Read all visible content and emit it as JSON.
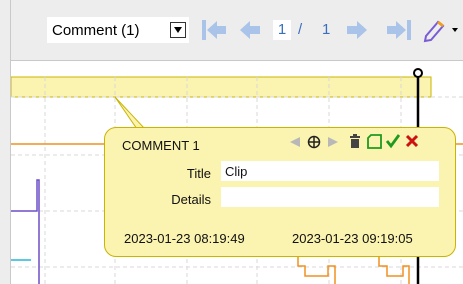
{
  "toolbar": {
    "comment_select_value": "Comment (1)",
    "current_page": "1",
    "page_separator": "/",
    "total_pages": "1"
  },
  "comment": {
    "header": "COMMENT 1",
    "title_label": "Title",
    "title_value": "Clip",
    "details_label": "Details",
    "details_value": "",
    "start_time": "2023-01-23 08:19:49",
    "end_time": "2023-01-23 09:19:05"
  },
  "colors": {
    "callout_bg": "#fbf3b0",
    "nav_icon": "#a9c4e8",
    "page_text": "#3a6fbf",
    "confirm": "#1f9a1f",
    "delete": "#cc1111"
  }
}
